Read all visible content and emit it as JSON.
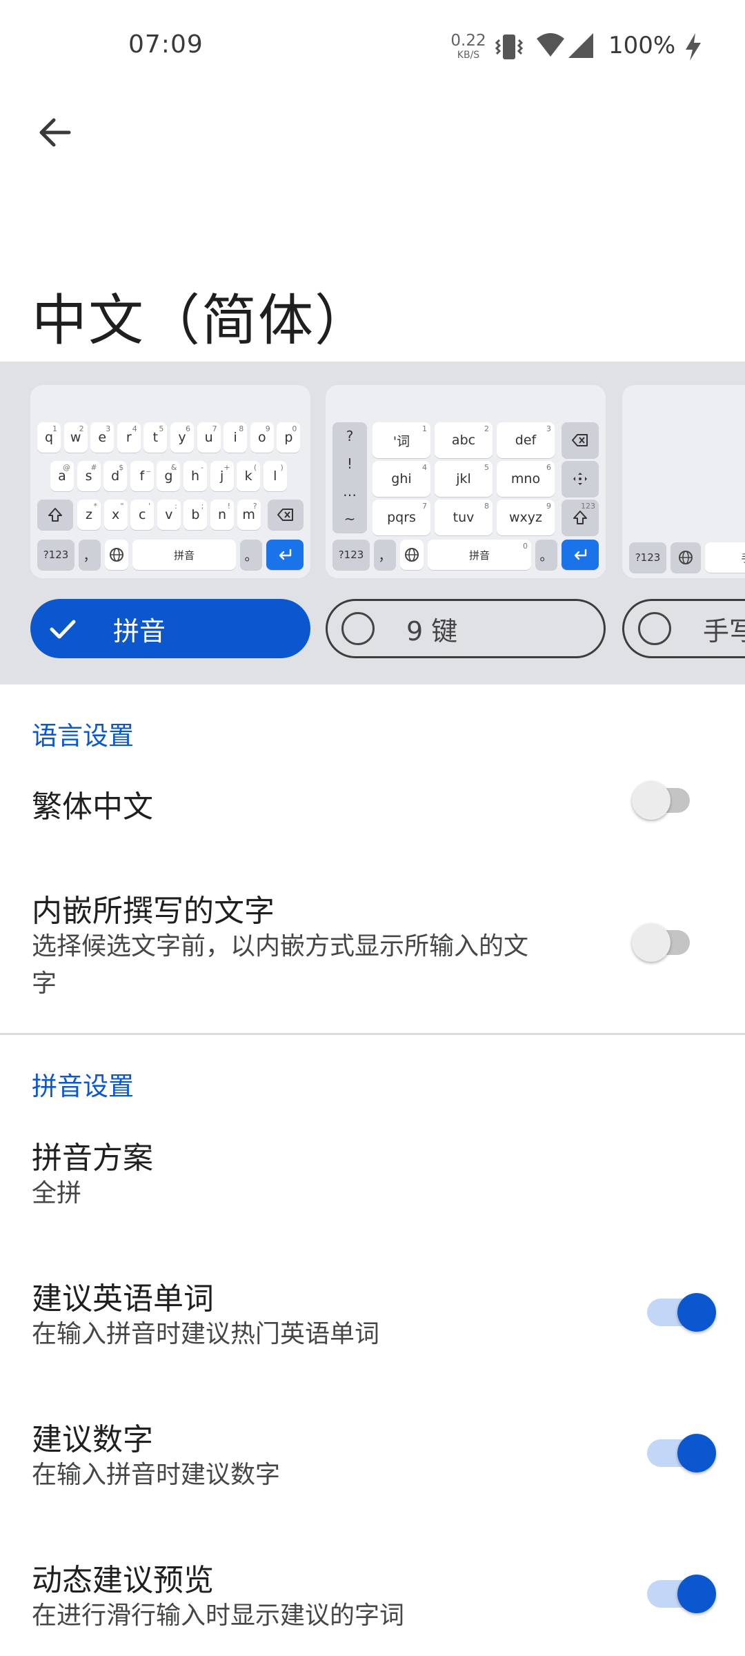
{
  "status_bar": {
    "time": "07:09",
    "net_speed_value": "0.22",
    "net_speed_unit": "KB/S",
    "battery": "100%"
  },
  "page": {
    "title": "中文（简体）"
  },
  "layouts": {
    "options": [
      {
        "label": "拼音",
        "selected": true
      },
      {
        "label": "9 键",
        "selected": false
      },
      {
        "label": "手写",
        "selected": false
      }
    ],
    "qwerty": {
      "row1": [
        "q",
        "w",
        "e",
        "r",
        "t",
        "y",
        "u",
        "i",
        "o",
        "p"
      ],
      "row1_hints": [
        "1",
        "2",
        "3",
        "4",
        "5",
        "6",
        "7",
        "8",
        "9",
        "0"
      ],
      "row2": [
        "a",
        "s",
        "d",
        "f",
        "g",
        "h",
        "j",
        "k",
        "l"
      ],
      "row2_hints": [
        "@",
        "#",
        "$",
        "_",
        "&",
        "-",
        "+",
        "(",
        ")"
      ],
      "row3": [
        "z",
        "x",
        "c",
        "v",
        "b",
        "n",
        "m"
      ],
      "row3_hints": [
        "*",
        "\"",
        "'",
        ":",
        ";",
        "!",
        "?"
      ],
      "sym": "?123",
      "comma": "，",
      "space": "拼音",
      "period": "。"
    },
    "nine_key": {
      "side": [
        "?",
        "!",
        "…",
        "~"
      ],
      "row1": [
        "'词",
        "abc",
        "def"
      ],
      "row1_hints": [
        "1",
        "2",
        "3"
      ],
      "row2": [
        "ghi",
        "jkl",
        "mno"
      ],
      "row2_hints": [
        "4",
        "5",
        "6"
      ],
      "row3": [
        "pqrs",
        "tuv",
        "wxyz"
      ],
      "row3_hints": [
        "7",
        "8",
        "9"
      ],
      "shift_hint": "123",
      "sym": "?123",
      "comma": "，",
      "space": "拼音",
      "space_hint": "0",
      "period": "。"
    },
    "handwriting": {
      "sym": "?123",
      "space": "手"
    }
  },
  "language_settings": {
    "header": "语言设置",
    "traditional": {
      "title": "繁体中文",
      "on": false
    },
    "inline": {
      "title": "内嵌所撰写的文字",
      "subtitle_line1": "选择候选文字前，以内嵌方式显示所输入的文",
      "subtitle_line2": "字",
      "on": false
    }
  },
  "pinyin_settings": {
    "header": "拼音设置",
    "scheme": {
      "title": "拼音方案",
      "value": "全拼"
    },
    "english": {
      "title": "建议英语单词",
      "subtitle": "在输入拼音时建议热门英语单词",
      "on": true
    },
    "numbers": {
      "title": "建议数字",
      "subtitle": "在输入拼音时建议数字",
      "on": true
    },
    "gesture": {
      "title": "动态建议预览",
      "subtitle": "在进行滑行输入时显示建议的字词",
      "on": true
    }
  },
  "colors": {
    "accent": "#0b57d0",
    "carousel_bg": "#dfe1e5",
    "enter_key": "#1a73e8"
  }
}
